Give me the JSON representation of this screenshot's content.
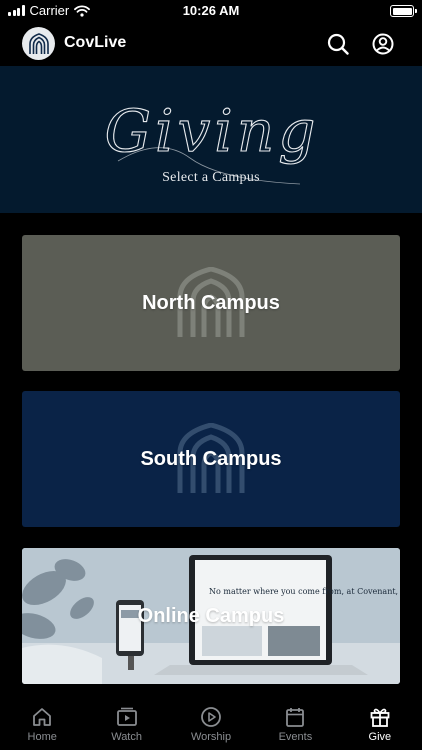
{
  "status_bar": {
    "carrier": "Carrier",
    "time": "10:26 AM"
  },
  "header": {
    "app_name": "CovLive",
    "logo_icon": "church-arch-icon",
    "search_icon": "search-icon",
    "profile_icon": "user-circle-icon"
  },
  "banner": {
    "script_title": "Giving",
    "subtitle": "Select a Campus",
    "background": "#041a2e"
  },
  "campuses": [
    {
      "label": "North Campus",
      "color": "#5b5d55"
    },
    {
      "label": "South Campus",
      "color": "#0a2347"
    },
    {
      "label": "Online Campus",
      "color": "#b6c4ce"
    }
  ],
  "online_photo": {
    "screen_headline": "No matter where you come from, at Covenant, you're home."
  },
  "tabs": [
    {
      "label": "Home",
      "icon": "home-icon",
      "active": false
    },
    {
      "label": "Watch",
      "icon": "video-play-icon",
      "active": false
    },
    {
      "label": "Worship",
      "icon": "play-circle-icon",
      "active": false
    },
    {
      "label": "Events",
      "icon": "calendar-icon",
      "active": false
    },
    {
      "label": "Give",
      "icon": "gift-icon",
      "active": true
    }
  ]
}
